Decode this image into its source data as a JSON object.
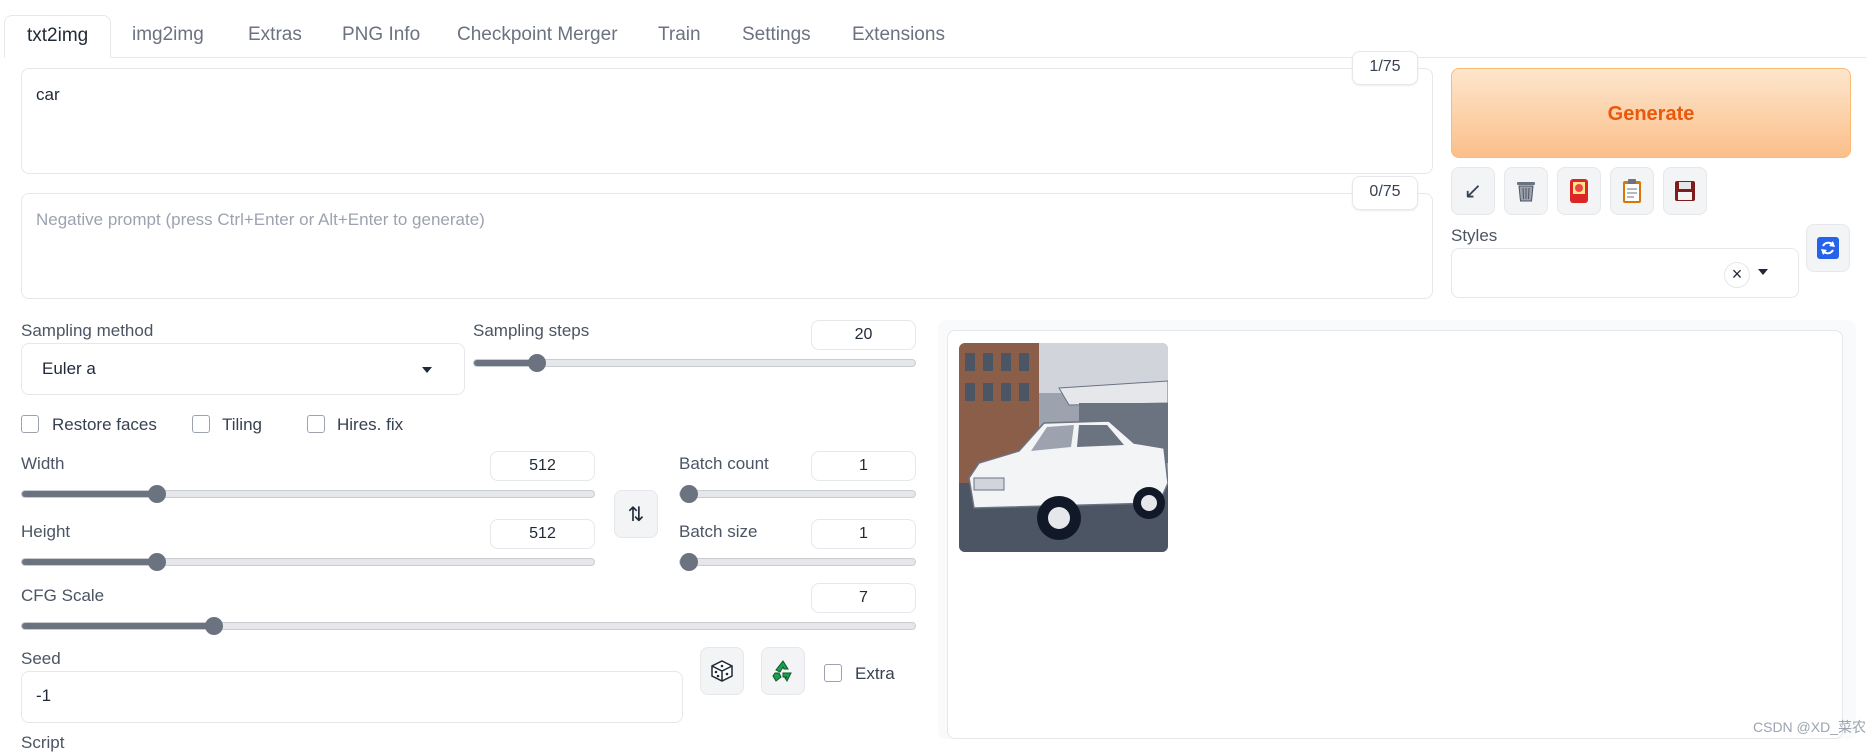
{
  "tabs": [
    "txt2img",
    "img2img",
    "Extras",
    "PNG Info",
    "Checkpoint Merger",
    "Train",
    "Settings",
    "Extensions"
  ],
  "prompt": {
    "value": "car",
    "counter": "1/75"
  },
  "negative_prompt": {
    "placeholder": "Negative prompt (press Ctrl+Enter or Alt+Enter to generate)",
    "counter": "0/75"
  },
  "generate": {
    "label": "Generate"
  },
  "styles": {
    "label": "Styles",
    "clear": "×"
  },
  "sampling": {
    "method_label": "Sampling method",
    "method_value": "Euler a",
    "steps_label": "Sampling steps",
    "steps_value": "20",
    "steps_fraction": 0.13
  },
  "checkboxes": {
    "restore_faces": "Restore faces",
    "tiling": "Tiling",
    "hires_fix": "Hires. fix"
  },
  "width": {
    "label": "Width",
    "value": "512"
  },
  "height": {
    "label": "Height",
    "value": "512"
  },
  "batch_count": {
    "label": "Batch count",
    "value": "1"
  },
  "batch_size": {
    "label": "Batch size",
    "value": "1"
  },
  "cfg": {
    "label": "CFG Scale",
    "value": "7"
  },
  "seed": {
    "label": "Seed",
    "value": "-1",
    "extra_label": "Extra",
    "next_label": "Script"
  },
  "watermark": "CSDN @XD_菜农",
  "colors": {
    "accent": "#ea580c",
    "slider": "#6b7280"
  }
}
